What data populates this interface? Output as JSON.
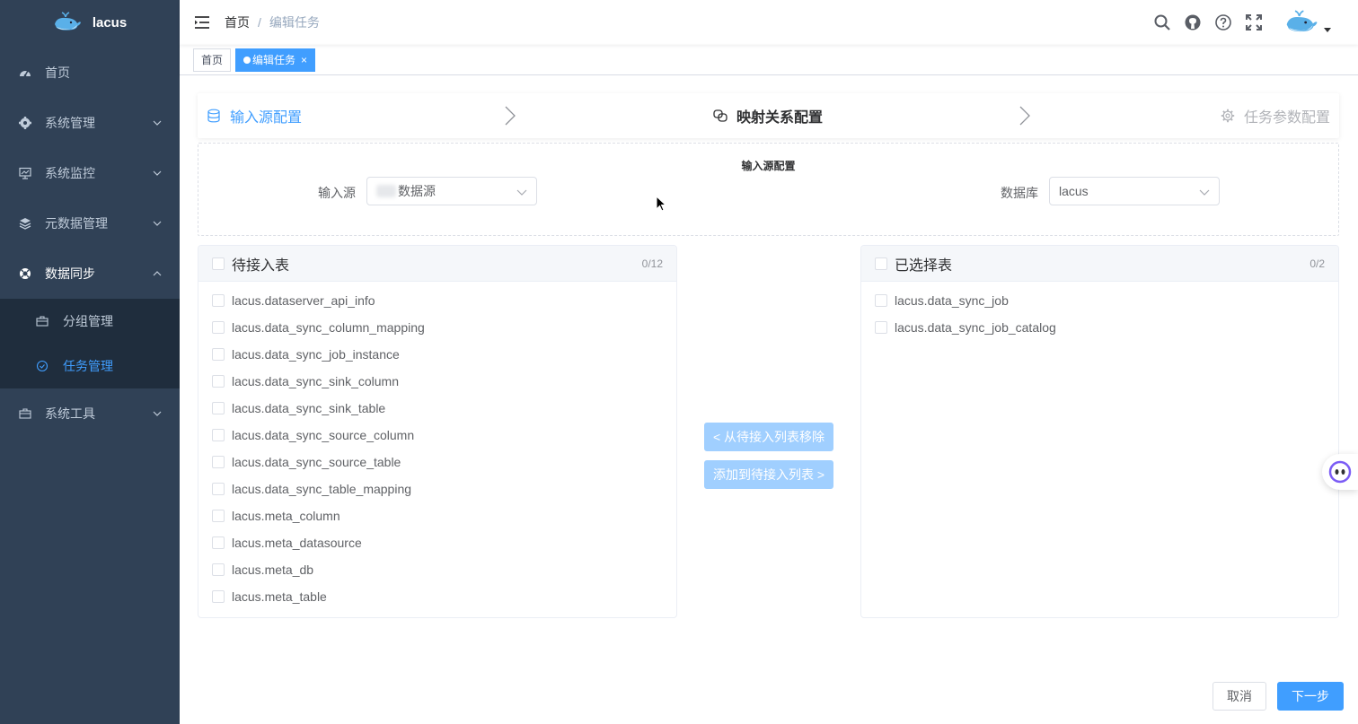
{
  "app": {
    "name": "lacus"
  },
  "sidebar": {
    "items": [
      {
        "label": "首页",
        "icon": "dashboard-icon"
      },
      {
        "label": "系统管理",
        "icon": "gear-icon"
      },
      {
        "label": "系统监控",
        "icon": "monitor-icon"
      },
      {
        "label": "元数据管理",
        "icon": "layers-icon"
      },
      {
        "label": "数据同步",
        "icon": "lifebuoy-icon",
        "expanded": true
      },
      {
        "label": "系统工具",
        "icon": "toolbox-icon"
      }
    ],
    "submenu": [
      {
        "label": "分组管理",
        "icon": "briefcase-icon"
      },
      {
        "label": "任务管理",
        "icon": "circle-check-icon",
        "active": true
      }
    ]
  },
  "breadcrumb": {
    "home": "首页",
    "separator": "/",
    "current": "编辑任务"
  },
  "tags": {
    "home": "首页",
    "active": "编辑任务"
  },
  "steps": {
    "s1": "输入源配置",
    "s2": "映射关系配置",
    "s3": "任务参数配置"
  },
  "source": {
    "title": "输入源配置",
    "input_label": "输入源",
    "input_value": "数据源",
    "db_label": "数据库",
    "db_value": "lacus"
  },
  "left_panel": {
    "title": "待接入表",
    "count": "0/12",
    "items": [
      "lacus.dataserver_api_info",
      "lacus.data_sync_column_mapping",
      "lacus.data_sync_job_instance",
      "lacus.data_sync_sink_column",
      "lacus.data_sync_sink_table",
      "lacus.data_sync_source_column",
      "lacus.data_sync_source_table",
      "lacus.data_sync_table_mapping",
      "lacus.meta_column",
      "lacus.meta_datasource",
      "lacus.meta_db",
      "lacus.meta_table"
    ]
  },
  "right_panel": {
    "title": "已选择表",
    "count": "0/2",
    "items": [
      "lacus.data_sync_job",
      "lacus.data_sync_job_catalog"
    ]
  },
  "transfer": {
    "remove_label": "< 从待接入列表移除",
    "add_label": "添加到待接入列表 >"
  },
  "footer": {
    "cancel": "取消",
    "next": "下一步"
  },
  "colors": {
    "sidebar_bg": "#304156",
    "primary": "#409eff",
    "disabled": "#a0cfff"
  }
}
